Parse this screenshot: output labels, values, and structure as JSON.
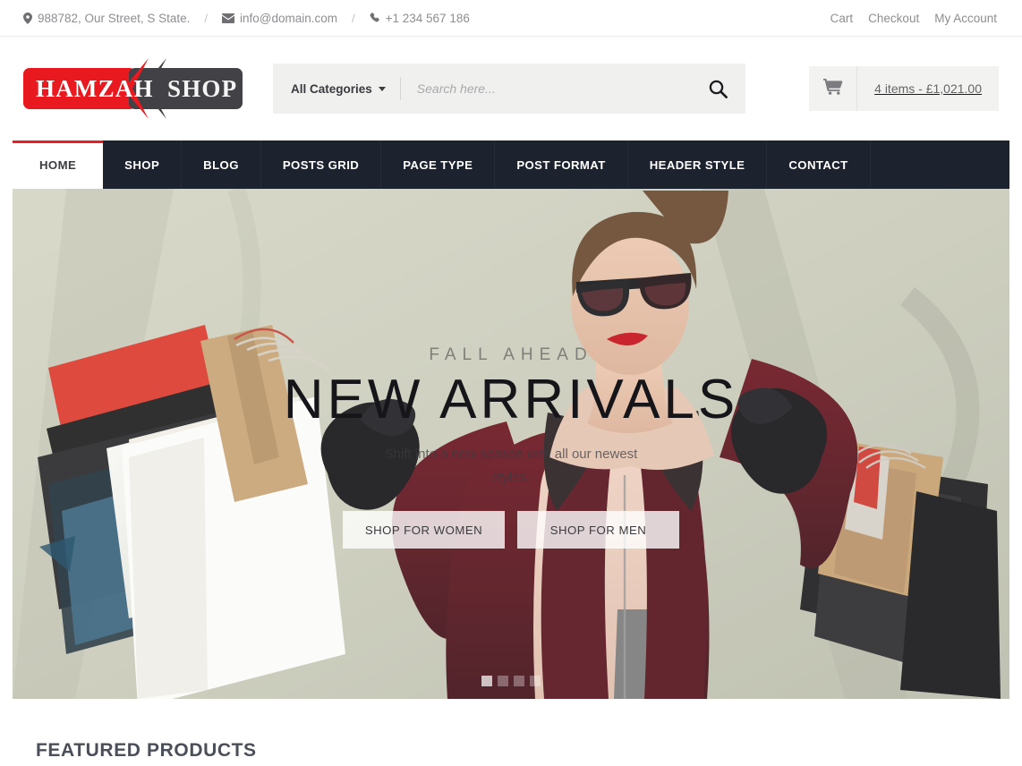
{
  "topbar": {
    "address": "988782, Our Street, S State.",
    "email": "info@domain.com",
    "phone": "+1 234 567 186",
    "separator": "/",
    "links": [
      {
        "label": "Cart"
      },
      {
        "label": "Checkout"
      },
      {
        "label": "My Account"
      }
    ]
  },
  "logo": {
    "left_text": "HAMZAH",
    "right_text": "SHOP",
    "red": "#e8191f",
    "dark": "#414146"
  },
  "search": {
    "category_label": "All Categories",
    "placeholder": "Search here...",
    "value": ""
  },
  "cart": {
    "summary": "4 items - £1,021.00"
  },
  "nav": {
    "items": [
      {
        "label": "HOME",
        "active": true
      },
      {
        "label": "SHOP",
        "active": false
      },
      {
        "label": "BLOG",
        "active": false
      },
      {
        "label": "POSTS GRID",
        "active": false
      },
      {
        "label": "PAGE TYPE",
        "active": false
      },
      {
        "label": "POST FORMAT",
        "active": false
      },
      {
        "label": "HEADER STYLE",
        "active": false
      },
      {
        "label": "CONTACT",
        "active": false
      }
    ],
    "active_accent": "#ec1c24",
    "background": "#1d232e"
  },
  "hero": {
    "kicker": "FALL AHEAD",
    "title": "NEW ARRIVALS",
    "subtitle": "Shift into a new season with all our newest styles.",
    "button_women": "SHOP FOR WOMEN",
    "button_men": "SHOP FOR MEN",
    "slides_total": 4,
    "slide_active": 1
  },
  "featured": {
    "heading": "FEATURED PRODUCTS"
  }
}
